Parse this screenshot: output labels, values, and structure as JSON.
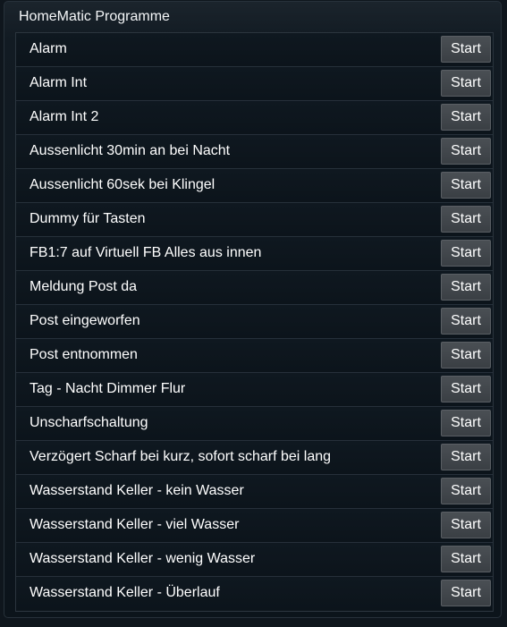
{
  "panel": {
    "title": "HomeMatic Programme"
  },
  "programs": [
    {
      "name": "Alarm",
      "action": "Start"
    },
    {
      "name": "Alarm Int",
      "action": "Start"
    },
    {
      "name": "Alarm Int 2",
      "action": "Start"
    },
    {
      "name": "Aussenlicht 30min an bei Nacht",
      "action": "Start"
    },
    {
      "name": "Aussenlicht 60sek bei Klingel",
      "action": "Start"
    },
    {
      "name": "Dummy für Tasten",
      "action": "Start"
    },
    {
      "name": "FB1:7 auf Virtuell FB Alles aus innen",
      "action": "Start"
    },
    {
      "name": "Meldung Post da",
      "action": "Start"
    },
    {
      "name": "Post eingeworfen",
      "action": "Start"
    },
    {
      "name": "Post entnommen",
      "action": "Start"
    },
    {
      "name": "Tag - Nacht Dimmer Flur",
      "action": "Start"
    },
    {
      "name": "Unscharfschaltung",
      "action": "Start"
    },
    {
      "name": "Verzögert Scharf bei kurz, sofort scharf bei lang",
      "action": "Start"
    },
    {
      "name": "Wasserstand Keller - kein Wasser",
      "action": "Start"
    },
    {
      "name": "Wasserstand Keller - viel Wasser",
      "action": "Start"
    },
    {
      "name": "Wasserstand Keller - wenig Wasser",
      "action": "Start"
    },
    {
      "name": "Wasserstand Keller - Überlauf",
      "action": "Start"
    }
  ],
  "colors": {
    "background": "#0f161d",
    "button": "#42474c",
    "text": "#ffffff"
  }
}
